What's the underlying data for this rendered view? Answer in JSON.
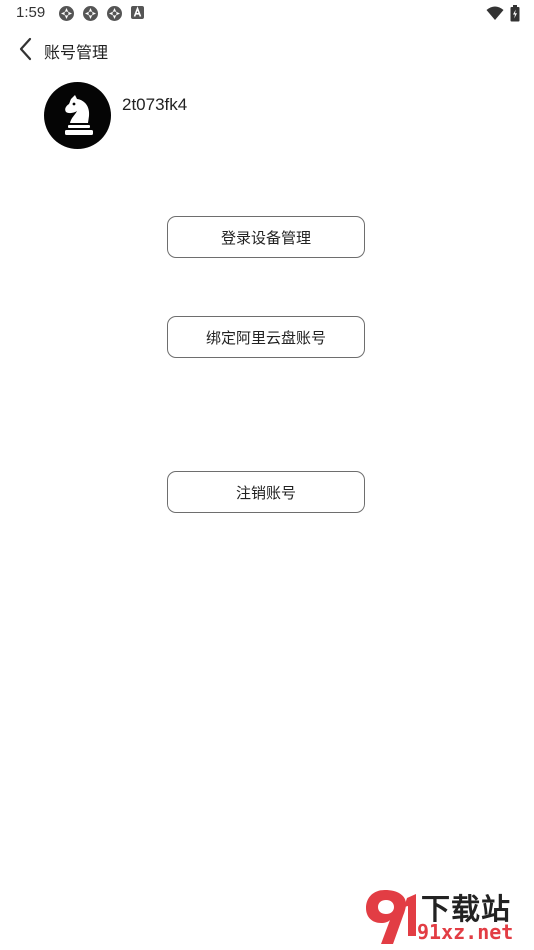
{
  "status_bar": {
    "time": "1:59",
    "left_icons": [
      "aperture-icon",
      "aperture-icon",
      "aperture-icon",
      "a-notification-icon"
    ],
    "right_icons": [
      "wifi-icon",
      "battery-icon"
    ]
  },
  "header": {
    "title": "账号管理",
    "back_icon": "chevron-left-icon"
  },
  "profile": {
    "avatar_icon": "chess-knight-icon",
    "username": "2t073fk4"
  },
  "actions": {
    "login_devices": "登录设备管理",
    "bind_aliyun": "绑定阿里云盘账号",
    "delete_account": "注销账号"
  },
  "watermark": {
    "logo_icon": "91-logo-icon",
    "text_top": "下载站",
    "text_bottom": "91xz.net",
    "accent_color": "#e23d44"
  },
  "colors": {
    "background": "#ffffff",
    "button_border": "#6e6e6e",
    "avatar_bg": "#050505"
  }
}
